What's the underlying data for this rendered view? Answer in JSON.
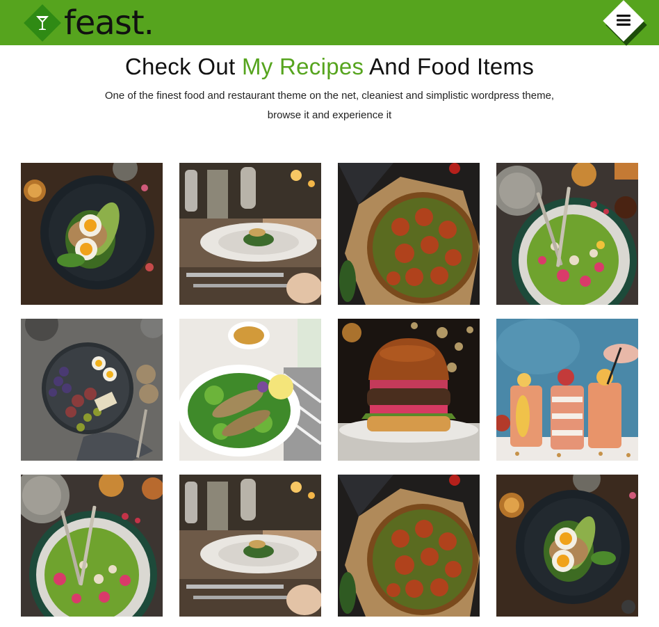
{
  "header": {
    "logo_text": "feast.",
    "logo_icon": "cocktail-glass-icon",
    "menu_icon": "hamburger-menu-icon",
    "brand_color": "#56a41e"
  },
  "intro": {
    "headline_before": "Check Out ",
    "headline_accent": "My Recipes",
    "headline_after": " And Food Items",
    "description": "One of the finest food and restaurant theme on the net, cleaniest and simplistic wordpress theme, browse it and experience it"
  },
  "gallery": {
    "items": [
      {
        "subject": "egg-avocado-toast-dark-plate"
      },
      {
        "subject": "plated-dish-restaurant-table"
      },
      {
        "subject": "tomato-tart-parchment"
      },
      {
        "subject": "green-salad-bowl-with-forks"
      },
      {
        "subject": "fig-egg-grazing-platter"
      },
      {
        "subject": "fish-fillet-salad-white-plate"
      },
      {
        "subject": "burger-on-plate"
      },
      {
        "subject": "smoothie-glasses"
      },
      {
        "subject": "green-salad-bowl-with-forks"
      },
      {
        "subject": "plated-dish-restaurant-table"
      },
      {
        "subject": "tomato-tart-parchment"
      },
      {
        "subject": "egg-avocado-toast-dark-plate"
      }
    ]
  }
}
